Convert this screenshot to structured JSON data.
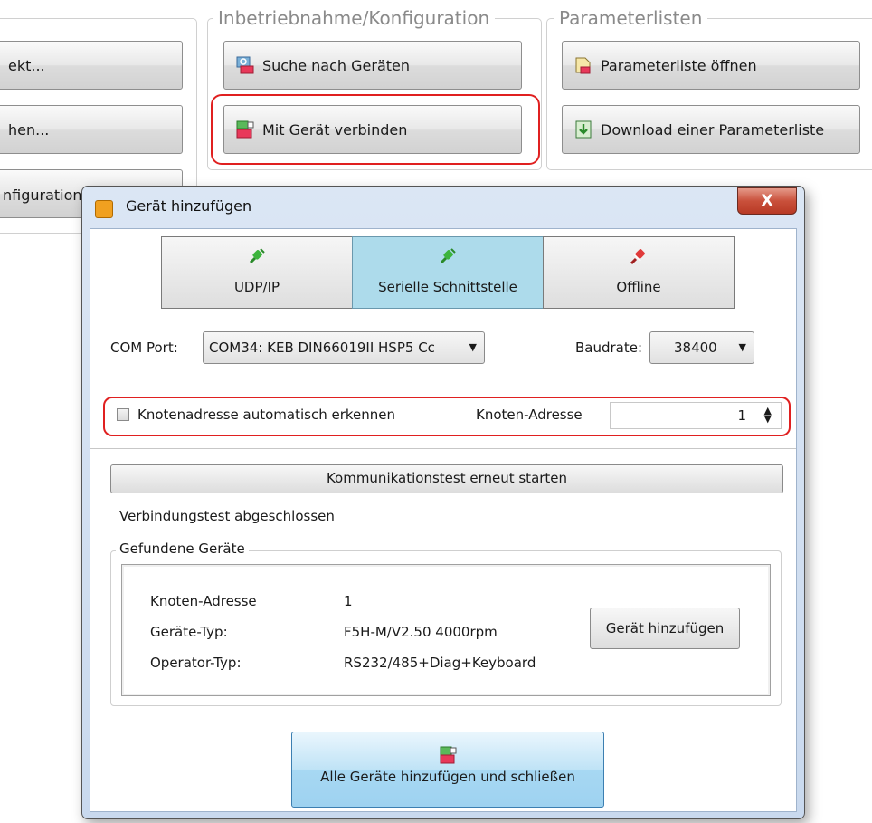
{
  "background_left": {
    "buttons": [
      {
        "label": "ekt..."
      },
      {
        "label": "hen..."
      },
      {
        "label": "nfiguration"
      }
    ]
  },
  "commissioning": {
    "title": "Inbetriebnahme/Konfiguration",
    "buttons": [
      {
        "label": "Suche nach Geräten",
        "icon": "device-search-icon"
      },
      {
        "label": "Mit Gerät verbinden",
        "icon": "device-connect-icon"
      }
    ]
  },
  "parameter_lists": {
    "title": "Parameterlisten",
    "buttons": [
      {
        "label": "Parameterliste öffnen",
        "icon": "open-file-icon"
      },
      {
        "label": "Download einer Parameterliste",
        "icon": "download-icon"
      }
    ]
  },
  "dialog": {
    "title": "Gerät hinzufügen",
    "close_glyph": "X",
    "tabs": [
      {
        "label": "UDP/IP",
        "icon": "green-plug-icon",
        "selected": false
      },
      {
        "label": "Serielle Schnittstelle",
        "icon": "green-plug-icon",
        "selected": true
      },
      {
        "label": "Offline",
        "icon": "red-plug-icon",
        "selected": false
      }
    ],
    "com_port_label": "COM Port:",
    "com_port_value": "COM34: KEB DIN66019II HSP5 Cc",
    "baudrate_label": "Baudrate:",
    "baudrate_value": "38400",
    "auto_node_label": "Knotenadresse automatisch erkennen",
    "auto_node_checked": false,
    "node_address_label": "Knoten-Adresse",
    "node_address_value": "1",
    "retest_button": "Kommunikationstest erneut starten",
    "status_text": "Verbindungstest abgeschlossen",
    "found_devices": {
      "title": "Gefundene Geräte",
      "rows": [
        {
          "label": "Knoten-Adresse",
          "value": "1"
        },
        {
          "label": "Geräte-Typ:",
          "value": "F5H-M/V2.50 4000rpm"
        },
        {
          "label": "Operator-Typ:",
          "value": "RS232/485+Diag+Keyboard"
        }
      ],
      "add_button": "Gerät hinzufügen"
    },
    "add_all_button": "Alle Geräte hinzufügen und schließen",
    "add_all_icon": "keb-device-icon"
  },
  "colors": {
    "highlight_red": "#e02020",
    "selected_tab": "#addbeb",
    "primary_button": "#a7d8f3"
  }
}
